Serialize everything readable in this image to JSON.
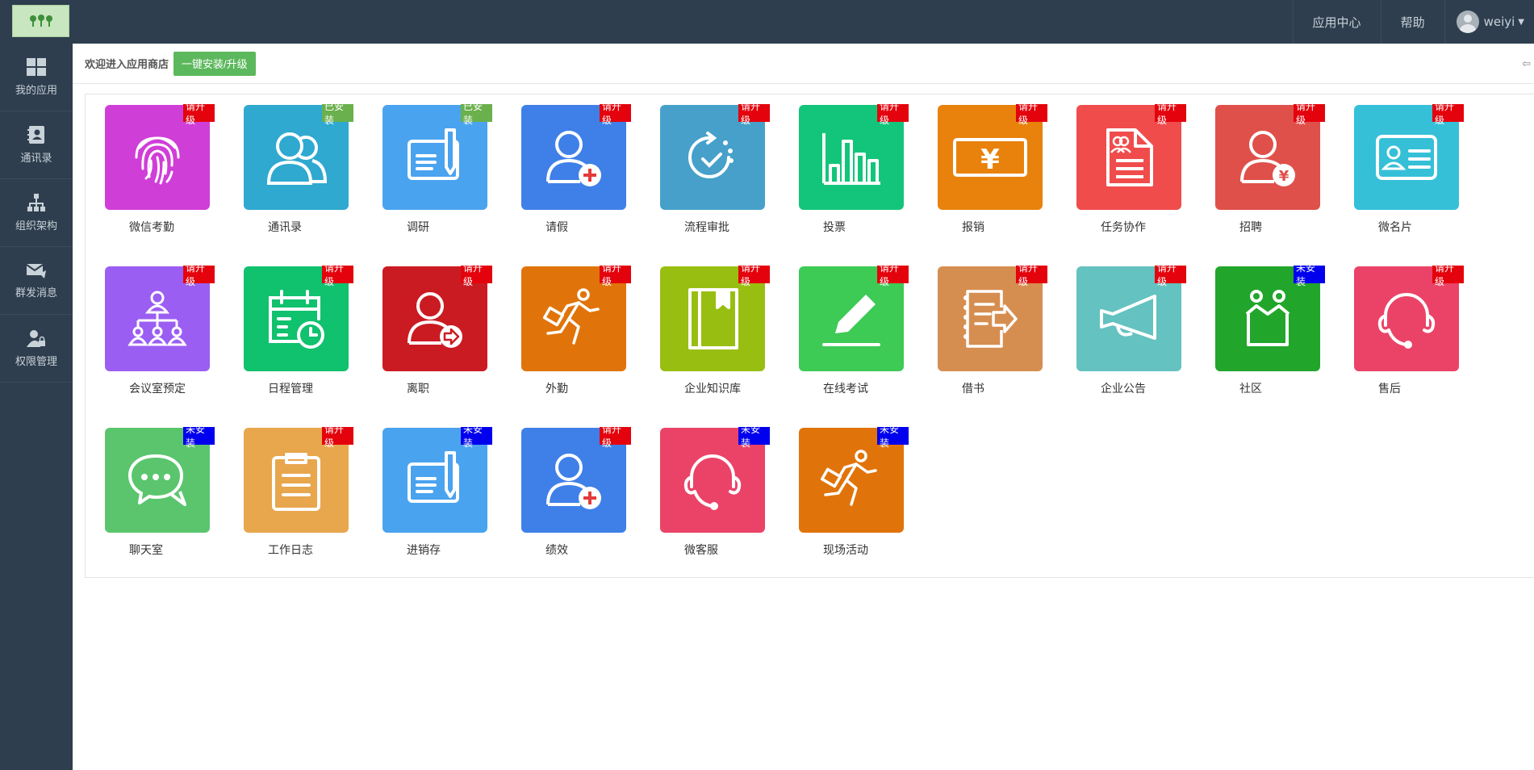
{
  "header": {
    "nav": [
      "应用中心",
      "帮助"
    ],
    "username": "weiyi"
  },
  "sidebar": {
    "items": [
      {
        "label": "我的应用",
        "icon": "grid-icon"
      },
      {
        "label": "通讯录",
        "icon": "contact-book-icon"
      },
      {
        "label": "组织架构",
        "icon": "org-chart-icon"
      },
      {
        "label": "群发消息",
        "icon": "message-icon"
      },
      {
        "label": "权限管理",
        "icon": "user-lock-icon"
      }
    ]
  },
  "toolbar": {
    "welcome": "欢迎进入应用商店",
    "install_label": "一键安装/升级"
  },
  "badges": {
    "upgrade": "请升级",
    "installed": "已安装",
    "notinstalled": "未安装"
  },
  "apps": [
    {
      "label": "微信考勤",
      "status": "请升级",
      "color": "#d03ed8",
      "icon": "fingerprint-icon"
    },
    {
      "label": "通讯录",
      "status": "已安装",
      "color": "#2fa9d0",
      "icon": "users-icon"
    },
    {
      "label": "调研",
      "status": "已安装",
      "color": "#4aa3ef",
      "icon": "survey-icon"
    },
    {
      "label": "请假",
      "status": "请升级",
      "color": "#3f80e8",
      "icon": "user-plus-icon"
    },
    {
      "label": "流程审批",
      "status": "请升级",
      "color": "#46a0ca",
      "icon": "approval-cycle-icon"
    },
    {
      "label": "投票",
      "status": "请升级",
      "color": "#13c57a",
      "icon": "bar-chart-icon"
    },
    {
      "label": "报销",
      "status": "请升级",
      "color": "#e8820c",
      "icon": "yen-card-icon"
    },
    {
      "label": "任务协作",
      "status": "请升级",
      "color": "#f04c4c",
      "icon": "task-doc-icon"
    },
    {
      "label": "招聘",
      "status": "请升级",
      "color": "#e0504a",
      "icon": "user-yen-icon"
    },
    {
      "label": "微名片",
      "status": "请升级",
      "color": "#35c0d8",
      "icon": "id-card-icon"
    },
    {
      "label": "会议室预定",
      "status": "请升级",
      "color": "#9b5ef2",
      "icon": "meeting-org-icon"
    },
    {
      "label": "日程管理",
      "status": "请升级",
      "color": "#10c16e",
      "icon": "calendar-clock-icon"
    },
    {
      "label": "离职",
      "status": "请升级",
      "color": "#cb1b22",
      "icon": "user-exit-icon"
    },
    {
      "label": "外勤",
      "status": "请升级",
      "color": "#e0740a",
      "icon": "runner-icon"
    },
    {
      "label": "企业知识库",
      "status": "请升级",
      "color": "#99be12",
      "icon": "book-icon"
    },
    {
      "label": "在线考试",
      "status": "请升级",
      "color": "#3dca55",
      "icon": "pen-icon"
    },
    {
      "label": "借书",
      "status": "请升级",
      "color": "#d68e50",
      "icon": "notebook-arrow-icon"
    },
    {
      "label": "企业公告",
      "status": "请升级",
      "color": "#64c2c0",
      "icon": "megaphone-icon"
    },
    {
      "label": "社区",
      "status": "未安装",
      "color": "#22a52b",
      "icon": "community-icon"
    },
    {
      "label": "售后",
      "status": "请升级",
      "color": "#eb4367",
      "icon": "headset-icon"
    },
    {
      "label": "聊天室",
      "status": "未安装",
      "color": "#5bc56e",
      "icon": "chat-icon"
    },
    {
      "label": "工作日志",
      "status": "请升级",
      "color": "#e8a64d",
      "icon": "clipboard-icon"
    },
    {
      "label": "进销存",
      "status": "未安装",
      "color": "#4aa3ef",
      "icon": "survey-icon"
    },
    {
      "label": "绩效",
      "status": "请升级",
      "color": "#3f80e8",
      "icon": "user-plus-icon"
    },
    {
      "label": "微客服",
      "status": "未安装",
      "color": "#eb4367",
      "icon": "headset-icon"
    },
    {
      "label": "现场活动",
      "status": "未安装",
      "color": "#e0740a",
      "icon": "runner-icon"
    }
  ]
}
